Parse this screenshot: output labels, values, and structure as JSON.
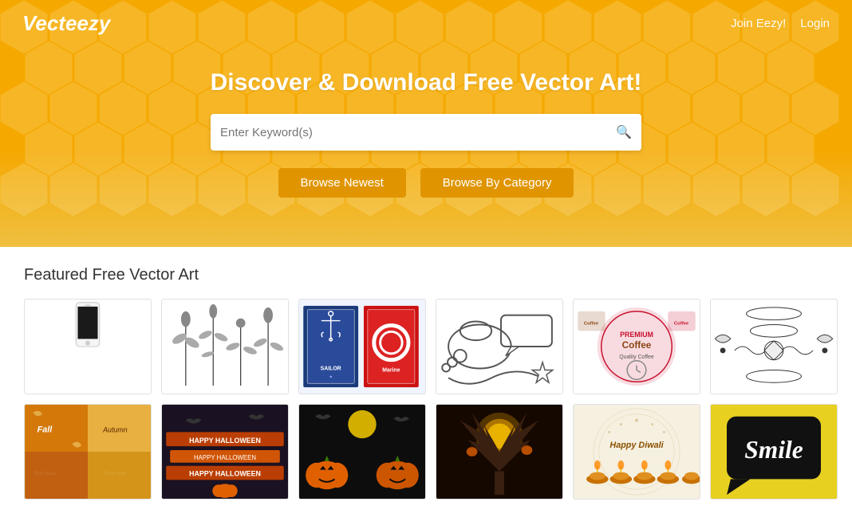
{
  "header": {
    "logo": "Vecteezy",
    "nav": {
      "join": "Join Eezy!",
      "login": "Login"
    },
    "hero_title": "Discover & Download Free Vector Art!",
    "search_placeholder": "Enter Keyword(s)",
    "browse_newest": "Browse Newest",
    "browse_category": "Browse By Category"
  },
  "main": {
    "section_title": "Featured Free Vector Art",
    "rows": [
      [
        {
          "id": "phone",
          "alt": "White smartphone vector"
        },
        {
          "id": "floral",
          "alt": "Floral botanical illustration"
        },
        {
          "id": "sailor",
          "alt": "Sailor marine stamp"
        },
        {
          "id": "speech",
          "alt": "Speech bubbles and star"
        },
        {
          "id": "coffee",
          "alt": "Coffee premium labels"
        },
        {
          "id": "ornament",
          "alt": "Ornamental floral borders"
        }
      ],
      [
        {
          "id": "fall",
          "alt": "Fall autumn collage"
        },
        {
          "id": "halloween-banner",
          "alt": "Happy Halloween banner"
        },
        {
          "id": "halloween-pumpkin",
          "alt": "Halloween pumpkins"
        },
        {
          "id": "halloween-tree",
          "alt": "Halloween tree illustration"
        },
        {
          "id": "diwali",
          "alt": "Happy Diwali candles"
        },
        {
          "id": "smile",
          "alt": "Smile speech bubble"
        }
      ]
    ]
  }
}
